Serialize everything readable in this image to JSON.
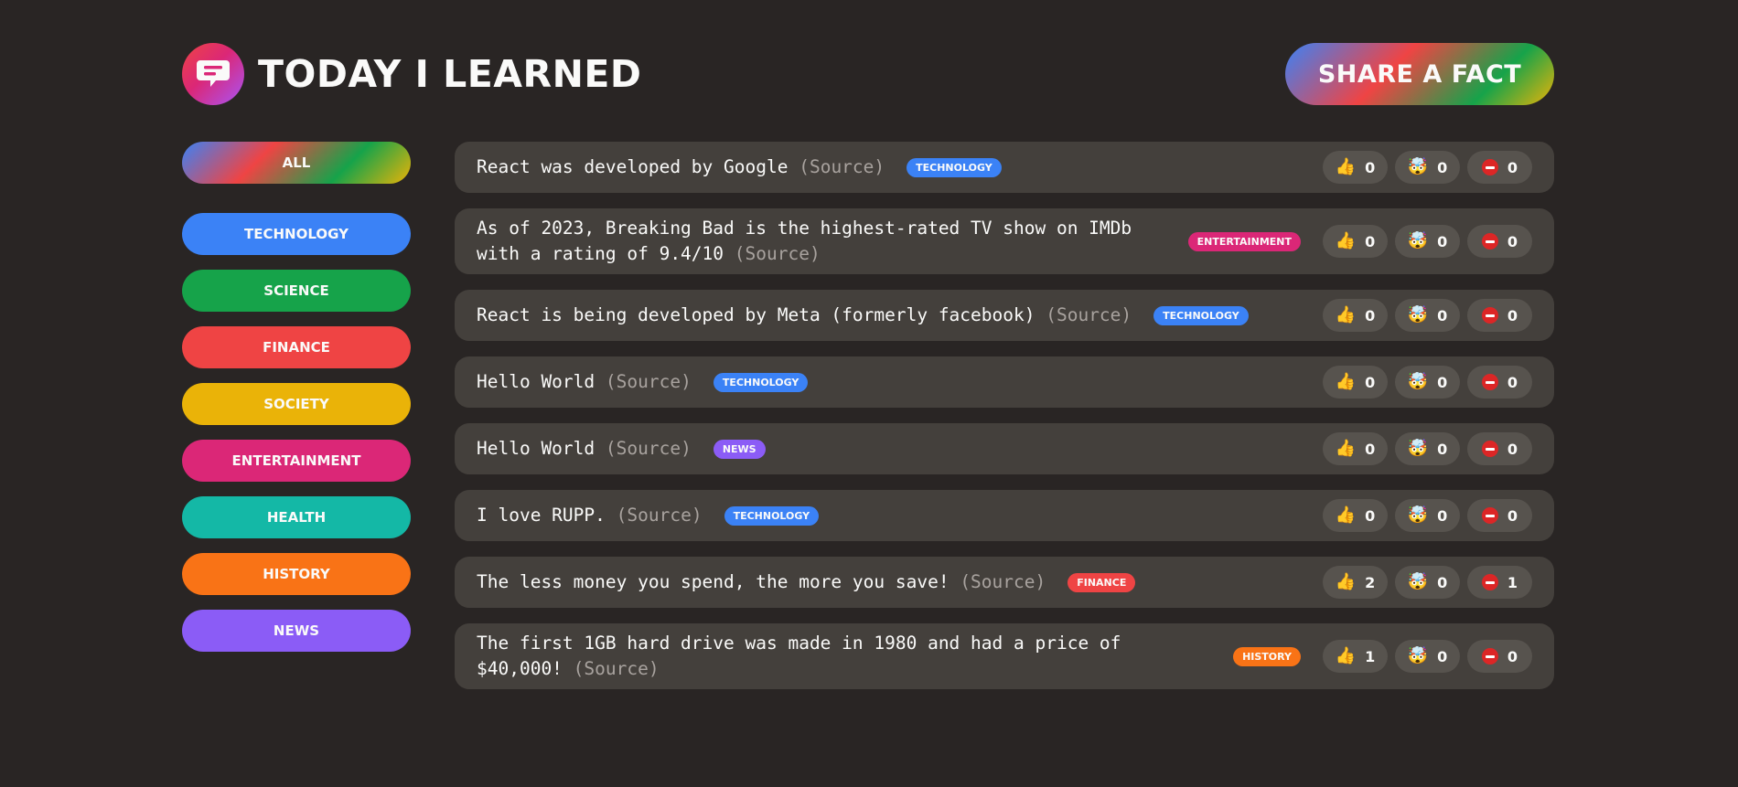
{
  "header": {
    "title": "Today I Learned",
    "share_label": "Share a fact",
    "logo_icon": "chat-bubble-icon"
  },
  "categories": [
    {
      "label": "All",
      "color": "gradient"
    },
    {
      "label": "technology",
      "color": "#3b82f6"
    },
    {
      "label": "science",
      "color": "#16a34a"
    },
    {
      "label": "finance",
      "color": "#ef4444"
    },
    {
      "label": "society",
      "color": "#eab308"
    },
    {
      "label": "entertainment",
      "color": "#db2777"
    },
    {
      "label": "health",
      "color": "#14b8a6"
    },
    {
      "label": "history",
      "color": "#f97316"
    },
    {
      "label": "news",
      "color": "#8b5cf6"
    }
  ],
  "facts": [
    {
      "text": "React was developed by Google",
      "source": "(Source)",
      "category": "technology",
      "color": "#3b82f6",
      "interesting": 0,
      "mindblowing": 0,
      "false": 0
    },
    {
      "text": "As of 2023, Breaking Bad is the highest-rated TV show on IMDb with a rating of 9.4/10",
      "source": "(Source)",
      "category": "entertainment",
      "color": "#db2777",
      "interesting": 0,
      "mindblowing": 0,
      "false": 0
    },
    {
      "text": "React is being developed by Meta (formerly facebook)",
      "source": "(Source)",
      "category": "technology",
      "color": "#3b82f6",
      "interesting": 0,
      "mindblowing": 0,
      "false": 0
    },
    {
      "text": "Hello World",
      "source": "(Source)",
      "category": "technology",
      "color": "#3b82f6",
      "interesting": 0,
      "mindblowing": 0,
      "false": 0
    },
    {
      "text": "Hello World",
      "source": "(Source)",
      "category": "news",
      "color": "#8b5cf6",
      "interesting": 0,
      "mindblowing": 0,
      "false": 0
    },
    {
      "text": "I love RUPP.",
      "source": "(Source)",
      "category": "technology",
      "color": "#3b82f6",
      "interesting": 0,
      "mindblowing": 0,
      "false": 0
    },
    {
      "text": "The less money you spend, the more you save!",
      "source": "(Source)",
      "category": "finance",
      "color": "#ef4444",
      "interesting": 2,
      "mindblowing": 0,
      "false": 1
    },
    {
      "text": "The first 1GB hard drive was made in 1980 and had a price of $40,000!",
      "source": "(Source)",
      "category": "history",
      "color": "#f97316",
      "interesting": 1,
      "mindblowing": 0,
      "false": 0
    }
  ],
  "vote_icons": {
    "interesting": "👍",
    "mindblowing": "🤯",
    "false": "stop-icon"
  }
}
